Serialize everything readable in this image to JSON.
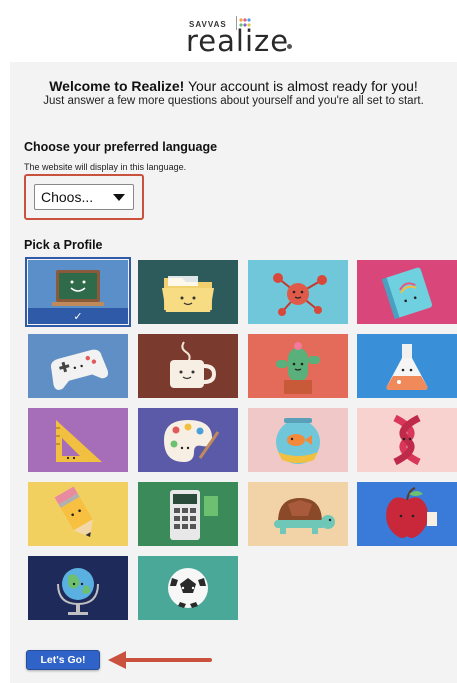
{
  "header": {
    "brand": "SAVVAS",
    "product": "realize",
    "dot_colors": [
      "#f2a43a",
      "#e05c8a",
      "#4c9ee0",
      "#6cc070",
      "#8a62c9",
      "#e0d040"
    ]
  },
  "welcome": {
    "title_bold": "Welcome to Realize!",
    "title_rest": " Your account is almost ready for you!",
    "subtitle": "Just answer a few more questions about yourself and you're all set to start."
  },
  "language": {
    "heading": "Choose your preferred language",
    "help": "The website will display in this language.",
    "selected": "Choos...",
    "highlight_color": "#c9513e"
  },
  "profile": {
    "heading": "Pick a Profile",
    "selected_check": "✓",
    "tiles": [
      {
        "name": "chalkboard",
        "bg": "#5a8fc9",
        "selected": true
      },
      {
        "name": "folder",
        "bg": "#2d5b5c",
        "selected": false
      },
      {
        "name": "molecule",
        "bg": "#6fc7d9",
        "selected": false
      },
      {
        "name": "notebook",
        "bg": "#d9477a",
        "selected": false
      },
      {
        "name": "game-controller",
        "bg": "#5f8fc4",
        "selected": false
      },
      {
        "name": "coffee-cup",
        "bg": "#7a3a2e",
        "selected": false
      },
      {
        "name": "cactus",
        "bg": "#e46a5a",
        "selected": false
      },
      {
        "name": "flask",
        "bg": "#3a8fd9",
        "selected": false
      },
      {
        "name": "ruler-triangle",
        "bg": "#a66db8",
        "selected": false
      },
      {
        "name": "paint-palette",
        "bg": "#5a5aa8",
        "selected": false
      },
      {
        "name": "fish-bowl",
        "bg": "#f0c8c8",
        "selected": false
      },
      {
        "name": "dna",
        "bg": "#f7d2ce",
        "selected": false
      },
      {
        "name": "pencil",
        "bg": "#f2d060",
        "selected": false
      },
      {
        "name": "calculator",
        "bg": "#3a8a5a",
        "selected": false
      },
      {
        "name": "turtle",
        "bg": "#f2d3a8",
        "selected": false
      },
      {
        "name": "apple",
        "bg": "#3a7ad9",
        "selected": false
      },
      {
        "name": "globe",
        "bg": "#1e2a5a",
        "selected": false
      },
      {
        "name": "soccer-ball",
        "bg": "#4aa898",
        "selected": false
      }
    ]
  },
  "actions": {
    "go_label": "Let's Go!",
    "arrow_color": "#c9513e"
  }
}
